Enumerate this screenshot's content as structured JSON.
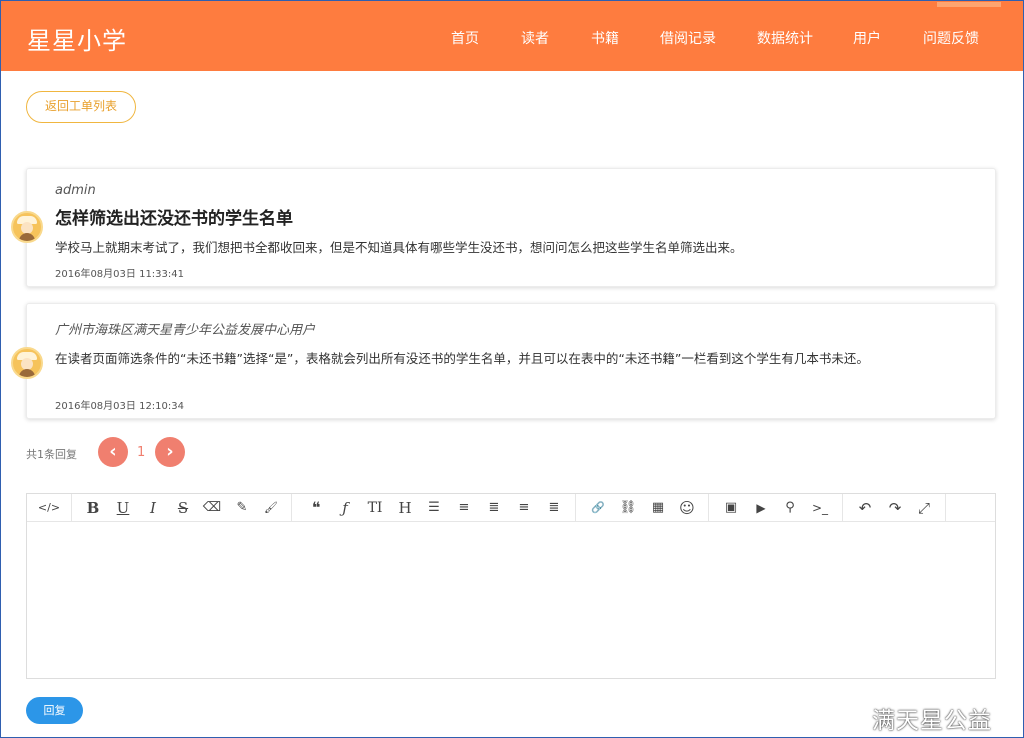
{
  "header": {
    "brand": "星星小学",
    "nav": [
      "首页",
      "读者",
      "书籍",
      "借阅记录",
      "数据统计",
      "用户",
      "问题反馈"
    ],
    "color": "#fe7c3f"
  },
  "back_button": "返回工单列表",
  "posts": [
    {
      "author": "admin",
      "title": "怎样筛选出还没还书的学生名单",
      "body": "学校马上就期末考试了，我们想把书全都收回来，但是不知道具体有哪些学生没还书，想问问怎么把这些学生名单筛选出来。",
      "time": "2016年08月03日 11:33:41"
    },
    {
      "author": "广州市海珠区满天星青少年公益发展中心用户",
      "body": "在读者页面筛选条件的“未还书籍”选择“是”，表格就会列出所有没还书的学生名单，并且可以在表中的“未还书籍”一栏看到这个学生有几本书未还。",
      "time": "2016年08月03日 12:10:34"
    }
  ],
  "pagination": {
    "count_text": "共1条回复",
    "prev": "‹",
    "current": "1",
    "next": "›"
  },
  "toolbar_icons": [
    {
      "name": "code-view-icon",
      "glyph": "</>"
    },
    {
      "name": "bold-icon",
      "glyph": "B"
    },
    {
      "name": "underline-icon",
      "glyph": "U"
    },
    {
      "name": "italic-icon",
      "glyph": "I"
    },
    {
      "name": "strikethrough-icon",
      "glyph": "S"
    },
    {
      "name": "eraser-icon",
      "glyph": "⌫"
    },
    {
      "name": "pencil-icon",
      "glyph": "✎"
    },
    {
      "name": "brush-icon",
      "glyph": "🖌"
    },
    {
      "name": "quote-icon",
      "glyph": "❝"
    },
    {
      "name": "font-icon",
      "glyph": "ƒ"
    },
    {
      "name": "text-height-icon",
      "glyph": "TI"
    },
    {
      "name": "heading-icon",
      "glyph": "H"
    },
    {
      "name": "bullet-list-icon",
      "glyph": "☰"
    },
    {
      "name": "numbered-list-icon",
      "glyph": "≡"
    },
    {
      "name": "align-left-icon",
      "glyph": "≣"
    },
    {
      "name": "align-center-icon",
      "glyph": "≡"
    },
    {
      "name": "align-right-icon",
      "glyph": "≣"
    },
    {
      "name": "link-icon",
      "glyph": "🔗"
    },
    {
      "name": "unlink-icon",
      "glyph": "⛓"
    },
    {
      "name": "table-icon",
      "glyph": "▦"
    },
    {
      "name": "emoji-icon",
      "glyph": "☺"
    },
    {
      "name": "image-icon",
      "glyph": "▣"
    },
    {
      "name": "video-icon",
      "glyph": "▶"
    },
    {
      "name": "map-marker-icon",
      "glyph": "⚲"
    },
    {
      "name": "terminal-icon",
      "glyph": ">_"
    },
    {
      "name": "undo-icon",
      "glyph": "↶"
    },
    {
      "name": "redo-icon",
      "glyph": "↷"
    },
    {
      "name": "fullscreen-icon",
      "glyph": "⤢"
    }
  ],
  "reply_button": "回复",
  "watermark": "满天星公益"
}
